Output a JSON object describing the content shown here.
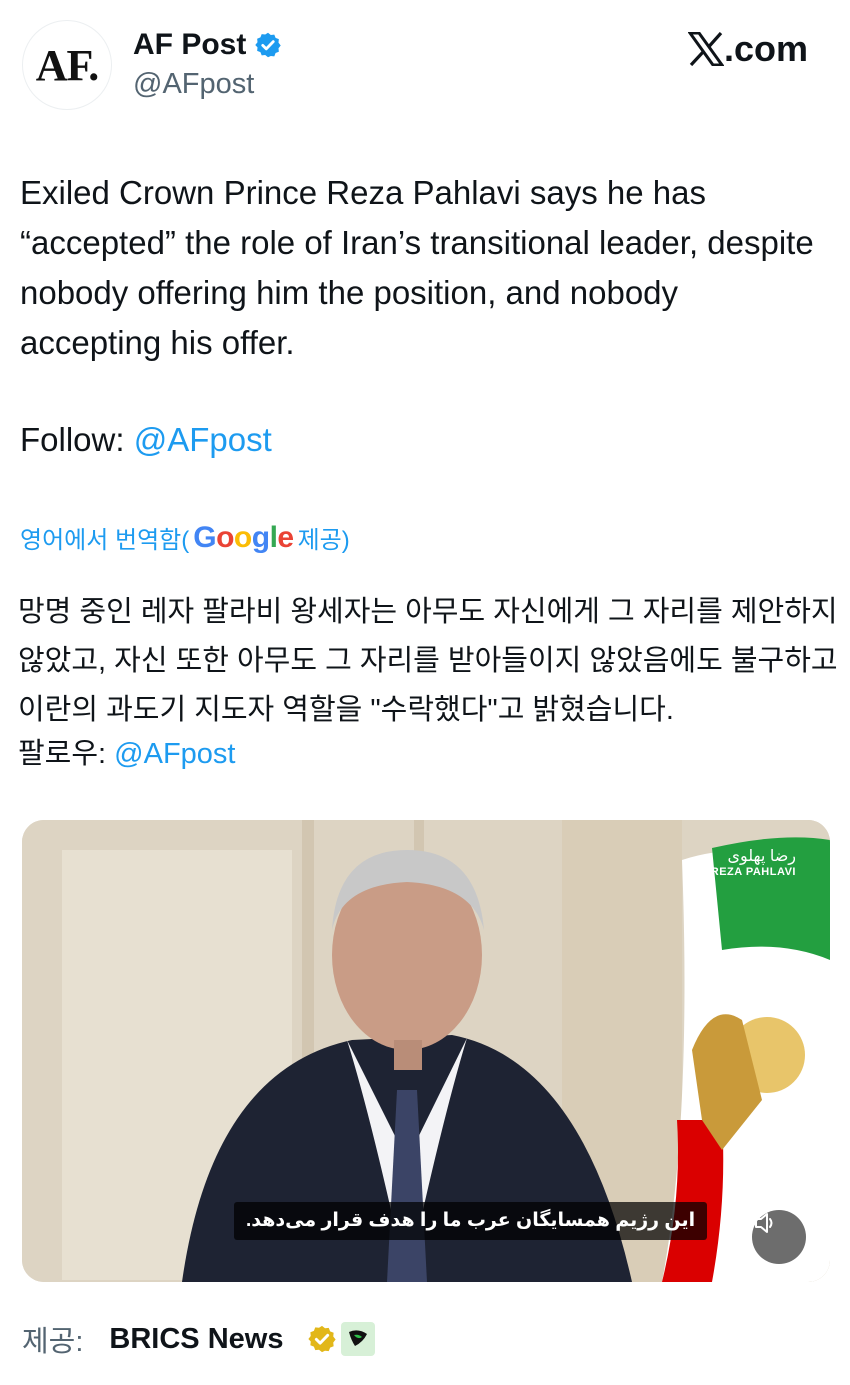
{
  "header": {
    "avatar_text": "AF.",
    "display_name": "AF Post",
    "handle": "@AFpost",
    "site": ".com"
  },
  "tweet": {
    "text": "Exiled Crown Prince Reza Pahlavi says he has “accepted” the role of Iran’s transitional leader, despite nobody offering him the position, and nobody accepting his offer.",
    "follow_label": "Follow: ",
    "follow_handle": "@AFpost"
  },
  "translation": {
    "prefix": "영어에서 번역함(",
    "google": [
      "G",
      "o",
      "o",
      "g",
      "l",
      "e"
    ],
    "suffix": " 제공)",
    "text": "망명 중인 레자 팔라비 왕세자는 아무도 자신에게 그 자리를 제안하지 않았고, 자신 또한 아무도 그 자리를 받아들이지 않았음에도 불구하고 이란의 과도기 지도자 역할을 \"수락했다\"고 밝혔습니다.",
    "follow_label": "팔로우: ",
    "follow_handle": "@AFpost"
  },
  "video": {
    "subtitle": "این رژیم همسایگان عرب ما را هدف قرار می‌دهد.",
    "watermark_fa": "رضا پهلوی",
    "watermark_en": "REZA PAHLAVI"
  },
  "provided": {
    "label": "제공:",
    "name": "BRICS News"
  },
  "colors": {
    "accent": "#1d9bf0",
    "verified_gold": "#e2b719",
    "flag_green": "#239f40",
    "flag_red": "#da0000"
  }
}
